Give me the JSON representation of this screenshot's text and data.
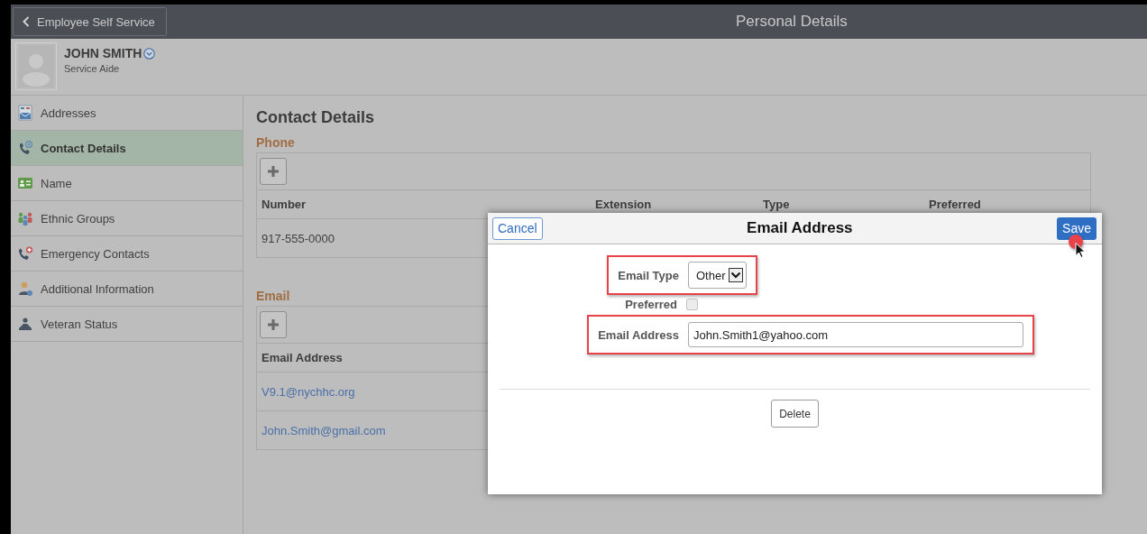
{
  "header": {
    "back_button": "Employee Self Service",
    "title": "Personal Details"
  },
  "profile": {
    "name": "JOHN SMITH",
    "job_title": "Service Aide"
  },
  "sidebar": {
    "items": [
      {
        "label": "Addresses",
        "kind": "addresses",
        "selected": false
      },
      {
        "label": "Contact Details",
        "kind": "contact",
        "selected": true
      },
      {
        "label": "Name",
        "kind": "name",
        "selected": false
      },
      {
        "label": "Ethnic Groups",
        "kind": "ethnic",
        "selected": false
      },
      {
        "label": "Emergency Contacts",
        "kind": "emergency",
        "selected": false
      },
      {
        "label": "Additional Information",
        "kind": "additional",
        "selected": false
      },
      {
        "label": "Veteran Status",
        "kind": "veteran",
        "selected": false
      }
    ]
  },
  "content": {
    "title": "Contact Details",
    "sections": [
      {
        "heading": "Phone",
        "columns": [
          "Number",
          "Extension",
          "Type",
          "Preferred"
        ],
        "rows": [
          [
            "917-555-0000"
          ]
        ],
        "kind": "plain"
      },
      {
        "heading": "Email",
        "columns": [
          "Email Address"
        ],
        "rows": [
          [
            "V9.1@nychhc.org"
          ],
          [
            "John.Smith@gmail.com"
          ]
        ],
        "kind": "link"
      }
    ]
  },
  "dialog": {
    "title": "Email Address",
    "cancel": "Cancel",
    "save": "Save",
    "fields": [
      {
        "kind": "select",
        "label": "Email Type",
        "value": "Other",
        "highlighted": true
      },
      {
        "kind": "checkbox",
        "label": "Preferred",
        "checked": false,
        "highlighted": false
      },
      {
        "kind": "text",
        "label": "Email Address",
        "value": "John.Smith1@yahoo.com",
        "highlighted": true
      }
    ],
    "delete": "Delete"
  }
}
